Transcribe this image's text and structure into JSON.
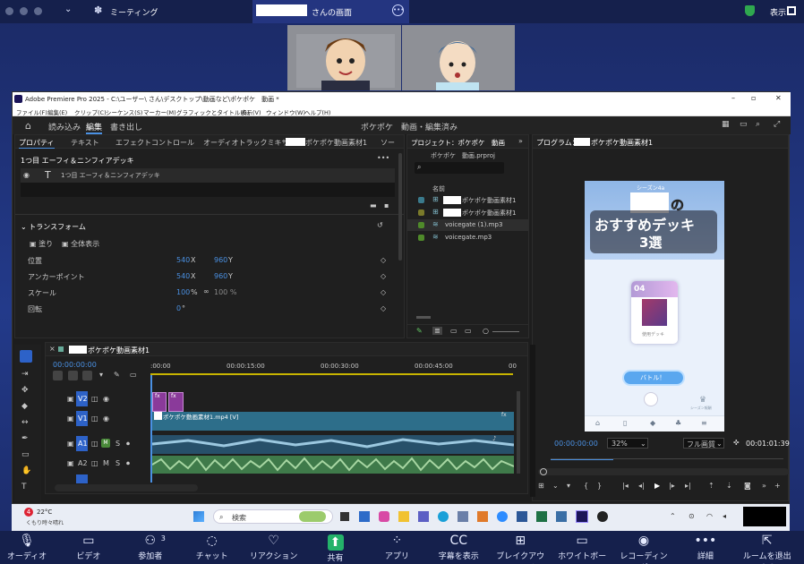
{
  "zoom_top": {
    "app": "ミーティング",
    "share_title_suffix": "さんの画面",
    "view": "表示"
  },
  "premiere": {
    "title": "Adobe Premiere Pro 2025 - C:\\ユーザー\\        さん\\デスクトップ\\動画など\\ポケポケ　動画 *",
    "menu": [
      "ファイル(F)",
      "編集(E)",
      "クリップ(C)",
      "シーケンス(S)",
      "マーカー(M)",
      "グラフィックとタイトル(G)",
      "表示(V)",
      "ウィンドウ(W)",
      "ヘルプ(H)"
    ],
    "ws_tabs": [
      "読み込み",
      "編集",
      "書き出し"
    ],
    "project_title": "ポケポケ　動画・編集済み",
    "left_tabs": [
      "プロパティ",
      "テキスト",
      "エフェクトコントロール",
      "オーディオトラックミキサー：",
      "ポケポケ動画素材1",
      "ソー"
    ],
    "clip_name": "1つ目 エーフィ＆ニンフィアデッキ",
    "layer_name": "1つ目 エーフィ＆ニンフィアデッキ",
    "transform": "トランスフォーム",
    "fill": "塗り",
    "show_all": "全体表示",
    "props": [
      {
        "name": "位置",
        "v1": "540",
        "u1": "X",
        "v2": "960",
        "u2": "Y"
      },
      {
        "name": "アンカーポイント",
        "v1": "540",
        "u1": "X",
        "v2": "960",
        "u2": "Y"
      },
      {
        "name": "スケール",
        "v1": "100",
        "u1": "%",
        "v2": "100 %",
        "u2": ""
      },
      {
        "name": "回転",
        "v1": "0",
        "u1": "°",
        "v2": "",
        "u2": ""
      }
    ],
    "project_panel": {
      "title": "プロジェクト：ポケポケ　動画",
      "file": "ポケポケ　動画.prproj",
      "col": "名前",
      "items": [
        "ポケポケ動画素材1",
        "ポケポケ動画素材1",
        "voicegate (1).mp3",
        "voicegate.mp3"
      ],
      "item_colors": [
        "#3a7a8c",
        "#7a7a2a",
        "#4f8a2a",
        "#4f8a2a"
      ]
    },
    "program": {
      "title": "プログラム：",
      "seq": "ポケポケ動画素材1",
      "timecode": "00:00:00:00",
      "zoom": "32%",
      "quality": "フル画質",
      "duration": "00:01:01:39"
    },
    "phone": {
      "header": "シーズン4a",
      "title1": "の",
      "title2": "おすすめデッキ",
      "title3": "3選",
      "card_num": "04",
      "card_label": "使用デッキ",
      "battle": "バトル！",
      "small": "シーズン報酬"
    },
    "timeline": {
      "seq": "ポケポケ動画素材1",
      "timecode": "00:00:00:00",
      "ruler": [
        ":00:00",
        "00:00:15:00",
        "00:00:30:00",
        "00:00:45:00",
        "00"
      ],
      "tracks": [
        "V2",
        "V1",
        "A1",
        "A2"
      ],
      "v1_clip": "ポケポケ動画素材1.mp4 [V]",
      "fx": "fx"
    }
  },
  "taskbar": {
    "temp": "22°C",
    "weather": "くもり時々晴れ",
    "search": "検索",
    "badge": "4"
  },
  "footer": [
    {
      "label": "オーディオ",
      "icon": "microphone-icon"
    },
    {
      "label": "ビデオ",
      "icon": "camera-icon"
    },
    {
      "label": "参加者",
      "icon": "people-icon",
      "count": "3"
    },
    {
      "label": "チャット",
      "icon": "chat-icon"
    },
    {
      "label": "リアクション",
      "icon": "heart-icon"
    },
    {
      "label": "共有",
      "icon": "share-icon"
    },
    {
      "label": "アプリ",
      "icon": "apps-icon"
    },
    {
      "label": "字幕を表示",
      "icon": "cc-icon"
    },
    {
      "label": "ブレイクアウト ルーム",
      "icon": "breakout-icon"
    },
    {
      "label": "ホワイトボード",
      "icon": "whiteboard-icon"
    },
    {
      "label": "レコーディング",
      "icon": "record-icon"
    },
    {
      "label": "詳細",
      "icon": "more-icon"
    },
    {
      "label": "ルームを退出する",
      "icon": "leave-icon"
    }
  ],
  "colors": {
    "accent": "#4a90e2",
    "v2clip": "#8a3a9a",
    "v1clip": "#2d6e8a",
    "audio": "#3f7a4a"
  }
}
